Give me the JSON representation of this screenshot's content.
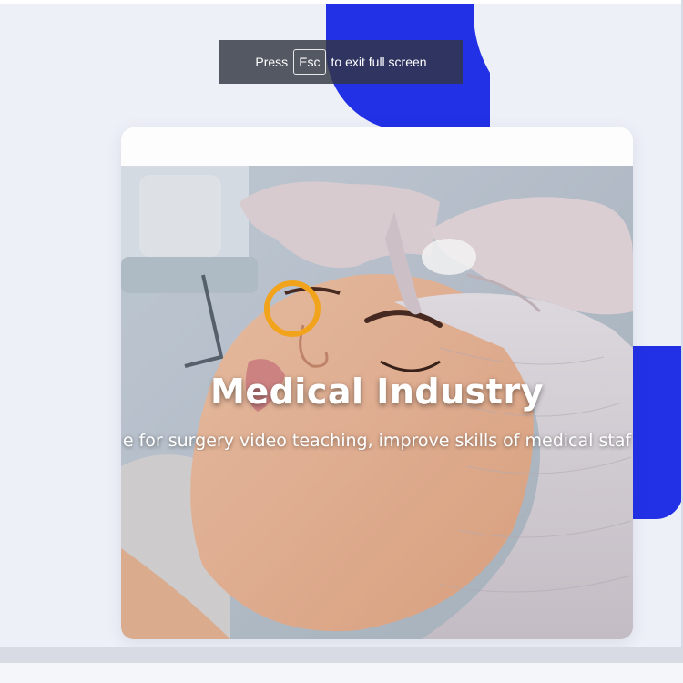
{
  "toast": {
    "press": "Press",
    "key": "Esc",
    "message": "to exit full screen"
  },
  "slide": {
    "title": "Medical Industry",
    "subtitle": "e for surgery video teaching, improve skills of medical staf"
  },
  "colors": {
    "accent_blue": "#2231e6",
    "focus_orange": "#f2a31c",
    "page_background": "#eef0f8"
  },
  "icons": {
    "focus_marker": "focus-ring-icon"
  }
}
